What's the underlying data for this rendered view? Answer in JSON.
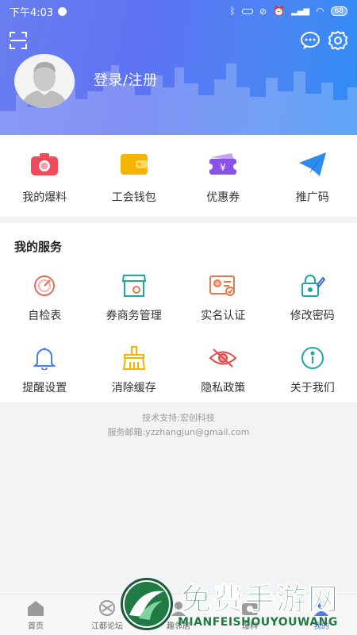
{
  "status_bar": {
    "time": "下午4:03",
    "battery": "68"
  },
  "header": {
    "login_text": "登录/注册",
    "icons": {
      "scan": "scan-icon",
      "message": "message-icon",
      "settings": "gear-icon"
    }
  },
  "quick_actions": [
    {
      "label": "我的爆料",
      "icon": "camera-icon",
      "color": "#f04b5a"
    },
    {
      "label": "工会钱包",
      "icon": "wallet-icon",
      "color": "#f5b400"
    },
    {
      "label": "优惠券",
      "icon": "coupon-icon",
      "color": "#8a52e8"
    },
    {
      "label": "推广码",
      "icon": "paper-plane-icon",
      "color": "#2d8cf0"
    }
  ],
  "services": {
    "title": "我的服务",
    "items": [
      {
        "label": "自检表",
        "icon": "gauge-icon",
        "color": "#e86b5a"
      },
      {
        "label": "券商务管理",
        "icon": "store-icon",
        "color": "#1fa8a0"
      },
      {
        "label": "实名认证",
        "icon": "id-card-icon",
        "color": "#e87a4a"
      },
      {
        "label": "修改密码",
        "icon": "lock-edit-icon",
        "color": "#1fa8a0"
      },
      {
        "label": "提醒设置",
        "icon": "bell-icon",
        "color": "#4a7cf4"
      },
      {
        "label": "消除缓存",
        "icon": "broom-icon",
        "color": "#f5b400"
      },
      {
        "label": "隐私政策",
        "icon": "eye-off-icon",
        "color": "#e04a4a"
      },
      {
        "label": "关于我们",
        "icon": "info-icon",
        "color": "#1fa8a0"
      }
    ]
  },
  "footer": {
    "support": "技术支持:宏创科技",
    "email": "服务邮箱:yzzhangjun@gmail.com"
  },
  "bottom_nav": [
    {
      "label": "首页",
      "icon": "home-icon"
    },
    {
      "label": "江都论坛",
      "icon": "forum-icon"
    },
    {
      "label": "趣邻居",
      "icon": "neighbor-icon"
    },
    {
      "label": "爆料",
      "icon": "report-icon"
    },
    {
      "label": "我的",
      "icon": "profile-icon"
    }
  ],
  "watermark": {
    "title": "免费手游网",
    "subtitle": "MIANFEISHOUYOUWANG"
  }
}
